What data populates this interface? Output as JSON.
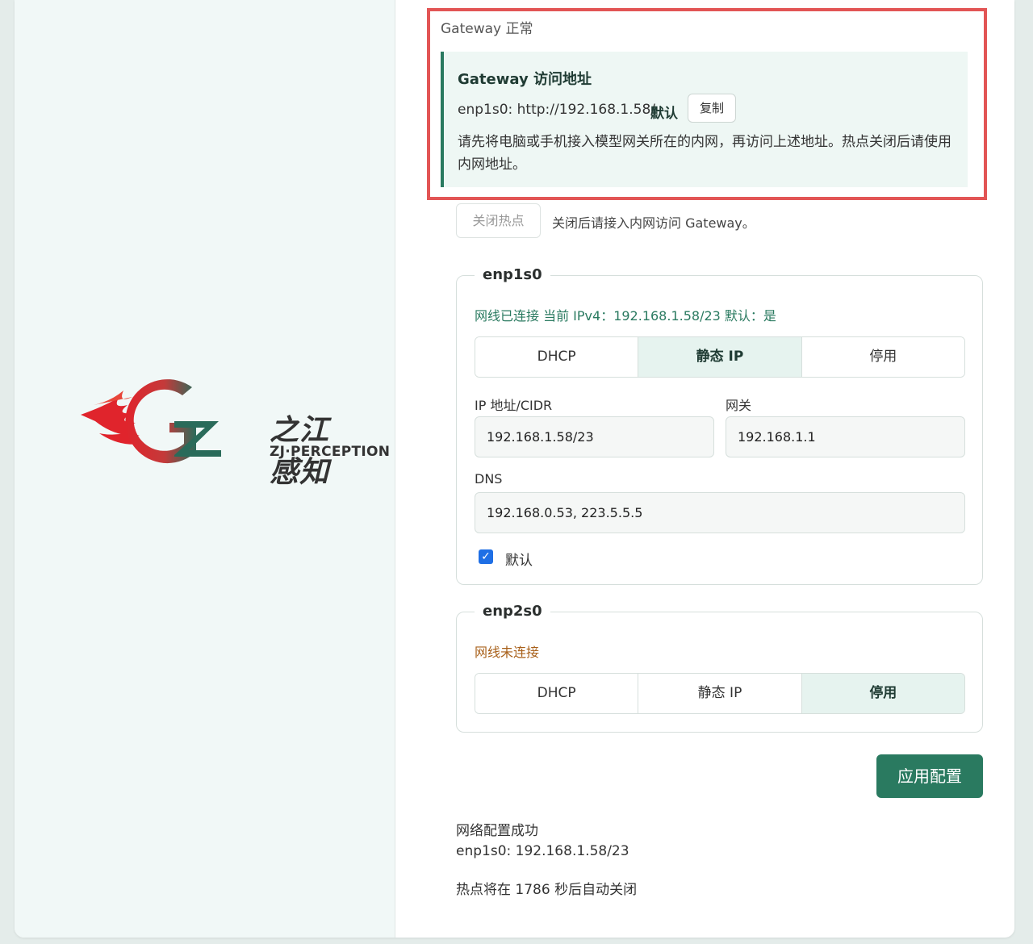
{
  "brand": {
    "name_cn": "之江感知",
    "name_en": "ZJ·PERCEPTION"
  },
  "gateway": {
    "status": "Gateway 正常",
    "panel_title": "Gateway 访问地址",
    "address": "enp1s0: http://192.168.1.58/",
    "default_tag": "默认",
    "copy_label": "复制",
    "note": "请先将电脑或手机接入模型网关所在的内网，再访问上述地址。热点关闭后请使用内网地址。"
  },
  "hotspot": {
    "close_label": "关闭热点",
    "note": "关闭后请接入内网访问 Gateway。"
  },
  "iface1": {
    "name": "enp1s0",
    "status": "网线已连接 当前 IPv4：192.168.1.58/23 默认：是",
    "modes": [
      "DHCP",
      "静态 IP",
      "停用"
    ],
    "active_mode": "静态 IP",
    "ip_label": "IP 地址/CIDR",
    "ip_value": "192.168.1.58/23",
    "gw_label": "网关",
    "gw_value": "192.168.1.1",
    "dns_label": "DNS",
    "dns_value": "192.168.0.53, 223.5.5.5",
    "default_label": "默认",
    "default_checked": true
  },
  "iface2": {
    "name": "enp2s0",
    "status": "网线未连接",
    "modes": [
      "DHCP",
      "静态 IP",
      "停用"
    ],
    "active_mode": "停用"
  },
  "apply_label": "应用配置",
  "result": {
    "title": "网络配置成功",
    "line": "enp1s0: 192.168.1.58/23",
    "hotspot_countdown": "热点将在 1786 秒后自动关闭"
  },
  "colors": {
    "accent": "#2a7a60",
    "highlight_border": "#e25555",
    "connected": "#2a7a60",
    "disconnected": "#a8601a",
    "checkbox": "#1f6fe5"
  }
}
